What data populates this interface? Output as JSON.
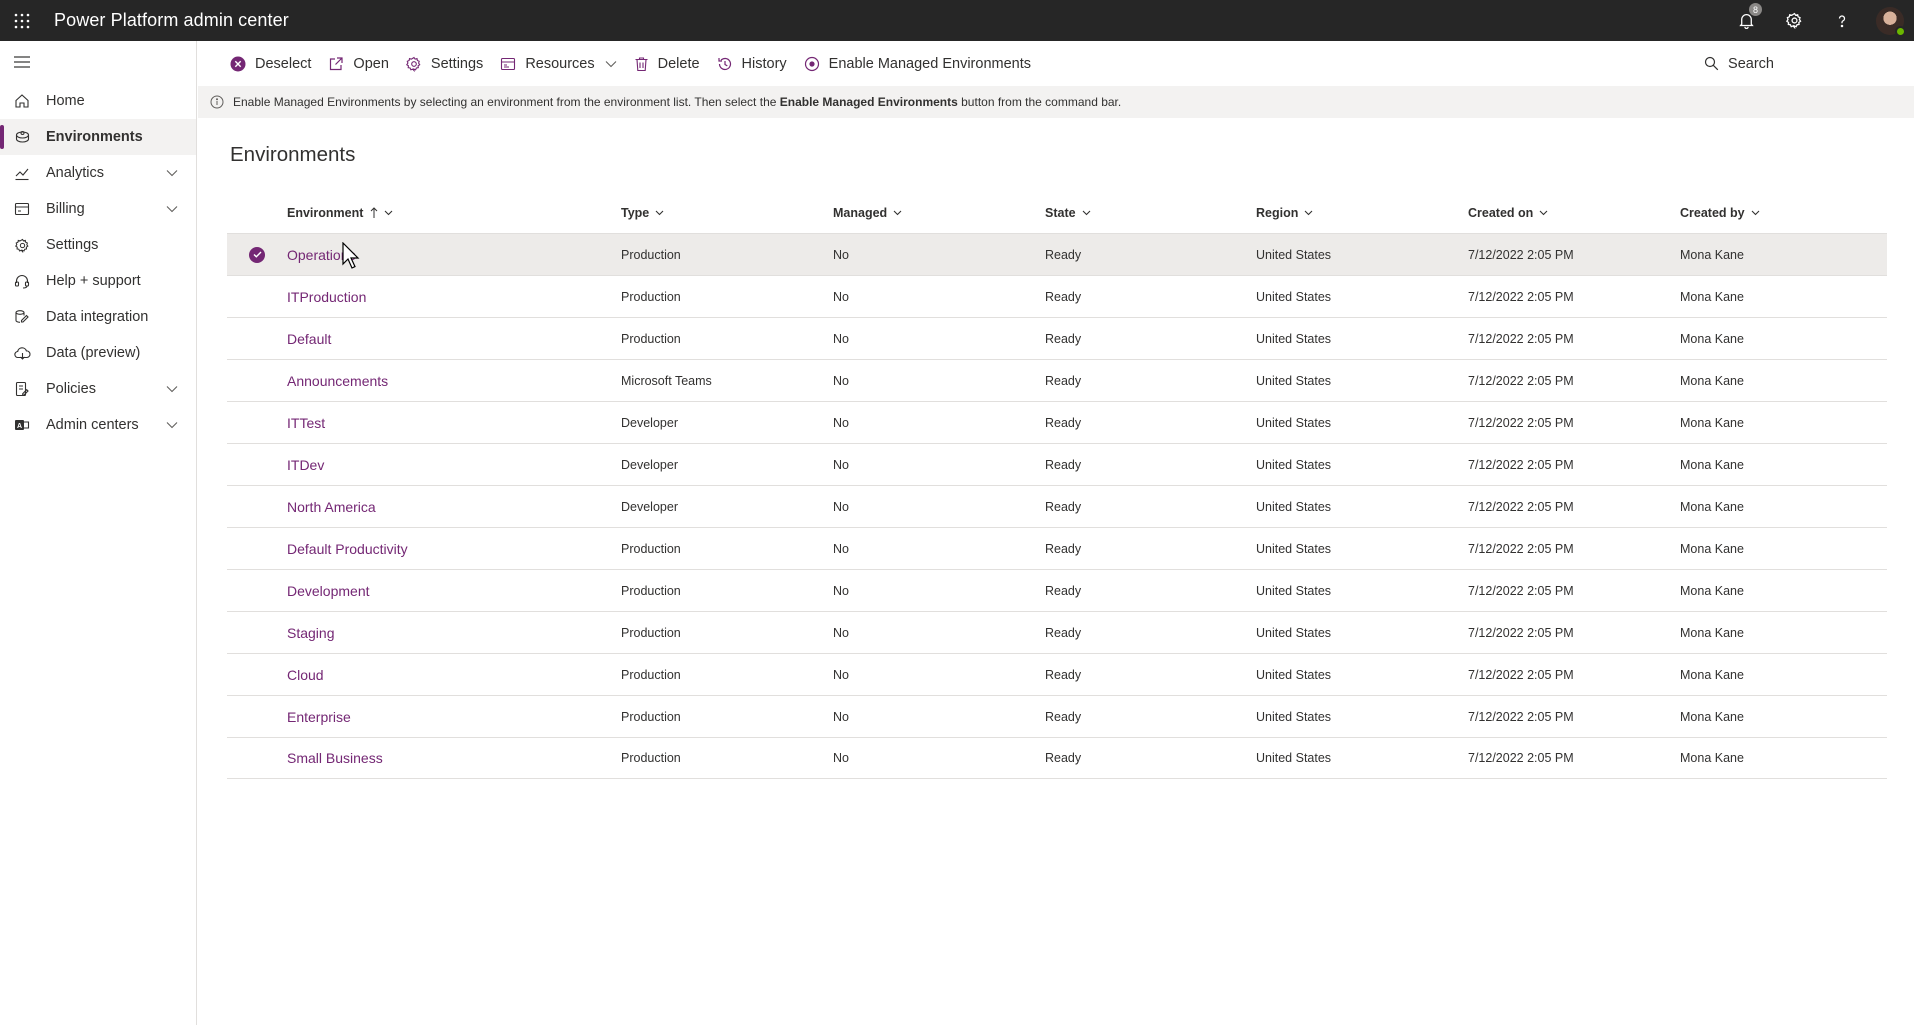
{
  "app": {
    "title": "Power Platform admin center",
    "notification_count": "8",
    "accent": "#742774"
  },
  "sidebar": {
    "items": [
      {
        "label": "Home",
        "icon": "home-icon",
        "expandable": false
      },
      {
        "label": "Environments",
        "icon": "environments-icon",
        "expandable": false,
        "active": true
      },
      {
        "label": "Analytics",
        "icon": "analytics-icon",
        "expandable": true
      },
      {
        "label": "Billing",
        "icon": "billing-icon",
        "expandable": true
      },
      {
        "label": "Settings",
        "icon": "gear-icon",
        "expandable": false
      },
      {
        "label": "Help + support",
        "icon": "headset-icon",
        "expandable": false
      },
      {
        "label": "Data integration",
        "icon": "data-integration-icon",
        "expandable": false
      },
      {
        "label": "Data (preview)",
        "icon": "cloud-icon",
        "expandable": false
      },
      {
        "label": "Policies",
        "icon": "policies-icon",
        "expandable": true
      },
      {
        "label": "Admin centers",
        "icon": "admin-centers-icon",
        "expandable": true
      }
    ]
  },
  "commandbar": {
    "deselect": "Deselect",
    "open": "Open",
    "settings": "Settings",
    "resources": "Resources",
    "delete": "Delete",
    "history": "History",
    "enable_managed": "Enable Managed Environments",
    "search": "Search"
  },
  "info": {
    "part1": "Enable Managed Environments by selecting an environment from the environment list. Then select the ",
    "bold": "Enable Managed Environments",
    "part2": " button from the command bar."
  },
  "page": {
    "title": "Environments"
  },
  "table": {
    "columns": [
      "Environment",
      "Type",
      "Managed",
      "State",
      "Region",
      "Created on",
      "Created by"
    ],
    "sorted_column": "Environment",
    "rows": [
      {
        "environment": "Operations",
        "type": "Production",
        "managed": "No",
        "state": "Ready",
        "region": "United States",
        "created_on": "7/12/2022 2:05 PM",
        "created_by": "Mona Kane",
        "selected": true
      },
      {
        "environment": "ITProduction",
        "type": "Production",
        "managed": "No",
        "state": "Ready",
        "region": "United States",
        "created_on": "7/12/2022 2:05 PM",
        "created_by": "Mona Kane"
      },
      {
        "environment": "Default",
        "type": "Production",
        "managed": "No",
        "state": "Ready",
        "region": "United States",
        "created_on": "7/12/2022 2:05 PM",
        "created_by": "Mona Kane"
      },
      {
        "environment": "Announcements",
        "type": "Microsoft Teams",
        "managed": "No",
        "state": "Ready",
        "region": "United States",
        "created_on": "7/12/2022 2:05 PM",
        "created_by": "Mona Kane"
      },
      {
        "environment": "ITTest",
        "type": "Developer",
        "managed": "No",
        "state": "Ready",
        "region": "United States",
        "created_on": "7/12/2022 2:05 PM",
        "created_by": "Mona Kane"
      },
      {
        "environment": "ITDev",
        "type": "Developer",
        "managed": "No",
        "state": "Ready",
        "region": "United States",
        "created_on": "7/12/2022 2:05 PM",
        "created_by": "Mona Kane"
      },
      {
        "environment": "North America",
        "type": "Developer",
        "managed": "No",
        "state": "Ready",
        "region": "United States",
        "created_on": "7/12/2022 2:05 PM",
        "created_by": "Mona Kane"
      },
      {
        "environment": "Default Productivity",
        "type": "Production",
        "managed": "No",
        "state": "Ready",
        "region": "United States",
        "created_on": "7/12/2022 2:05 PM",
        "created_by": "Mona Kane"
      },
      {
        "environment": "Development",
        "type": "Production",
        "managed": "No",
        "state": "Ready",
        "region": "United States",
        "created_on": "7/12/2022 2:05 PM",
        "created_by": "Mona Kane"
      },
      {
        "environment": "Staging",
        "type": "Production",
        "managed": "No",
        "state": "Ready",
        "region": "United States",
        "created_on": "7/12/2022 2:05 PM",
        "created_by": "Mona Kane"
      },
      {
        "environment": "Cloud",
        "type": "Production",
        "managed": "No",
        "state": "Ready",
        "region": "United States",
        "created_on": "7/12/2022 2:05 PM",
        "created_by": "Mona Kane"
      },
      {
        "environment": "Enterprise",
        "type": "Production",
        "managed": "No",
        "state": "Ready",
        "region": "United States",
        "created_on": "7/12/2022 2:05 PM",
        "created_by": "Mona Kane"
      },
      {
        "environment": "Small Business",
        "type": "Production",
        "managed": "No",
        "state": "Ready",
        "region": "United States",
        "created_on": "7/12/2022 2:05 PM",
        "created_by": "Mona Kane"
      }
    ]
  }
}
